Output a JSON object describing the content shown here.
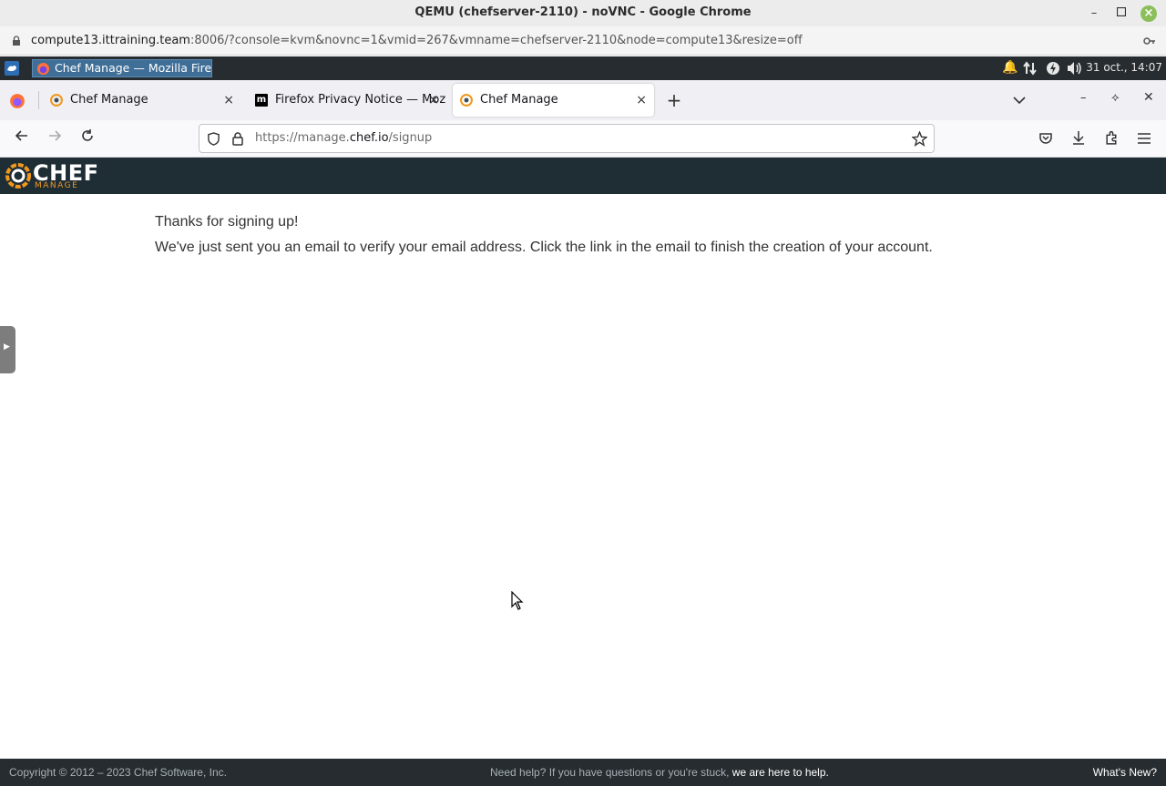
{
  "chrome": {
    "window_title": "QEMU (chefserver-2110) - noVNC - Google Chrome",
    "address_host": "compute13.ittraining.team",
    "address_rest": ":8006/?console=kvm&novnc=1&vmid=267&vmname=chefserver-2110&node=compute13&resize=off"
  },
  "xfce_panel": {
    "task_label": "Chef Manage — Mozilla Firef...",
    "clock": "31 oct., 14:07"
  },
  "firefox": {
    "tabs": [
      {
        "label": "Chef Manage",
        "close": "×"
      },
      {
        "label": "Firefox Privacy Notice — Mozi",
        "close": "×"
      },
      {
        "label": "Chef Manage",
        "close": "×"
      }
    ],
    "new_tab": "+",
    "url_prefix": "https://manage.",
    "url_domain": "chef.io",
    "url_path": "/signup"
  },
  "chef": {
    "logo_text": "CHEF",
    "logo_sub": "MANAGE",
    "heading": "Thanks for signing up!",
    "message": "We've just sent you an email to verify your email address. Click the link in the email to finish the creation of your account."
  },
  "footer": {
    "copyright": "Copyright © 2012 – 2023 Chef Software, Inc.",
    "help_text": "Need help? If you have questions or you're stuck, ",
    "help_link": "we are here to help.",
    "whats_new": "What's New?"
  },
  "colors": {
    "chef_header": "#1f2d35",
    "chef_orange": "#f09820",
    "footer_bg": "#262c30"
  }
}
